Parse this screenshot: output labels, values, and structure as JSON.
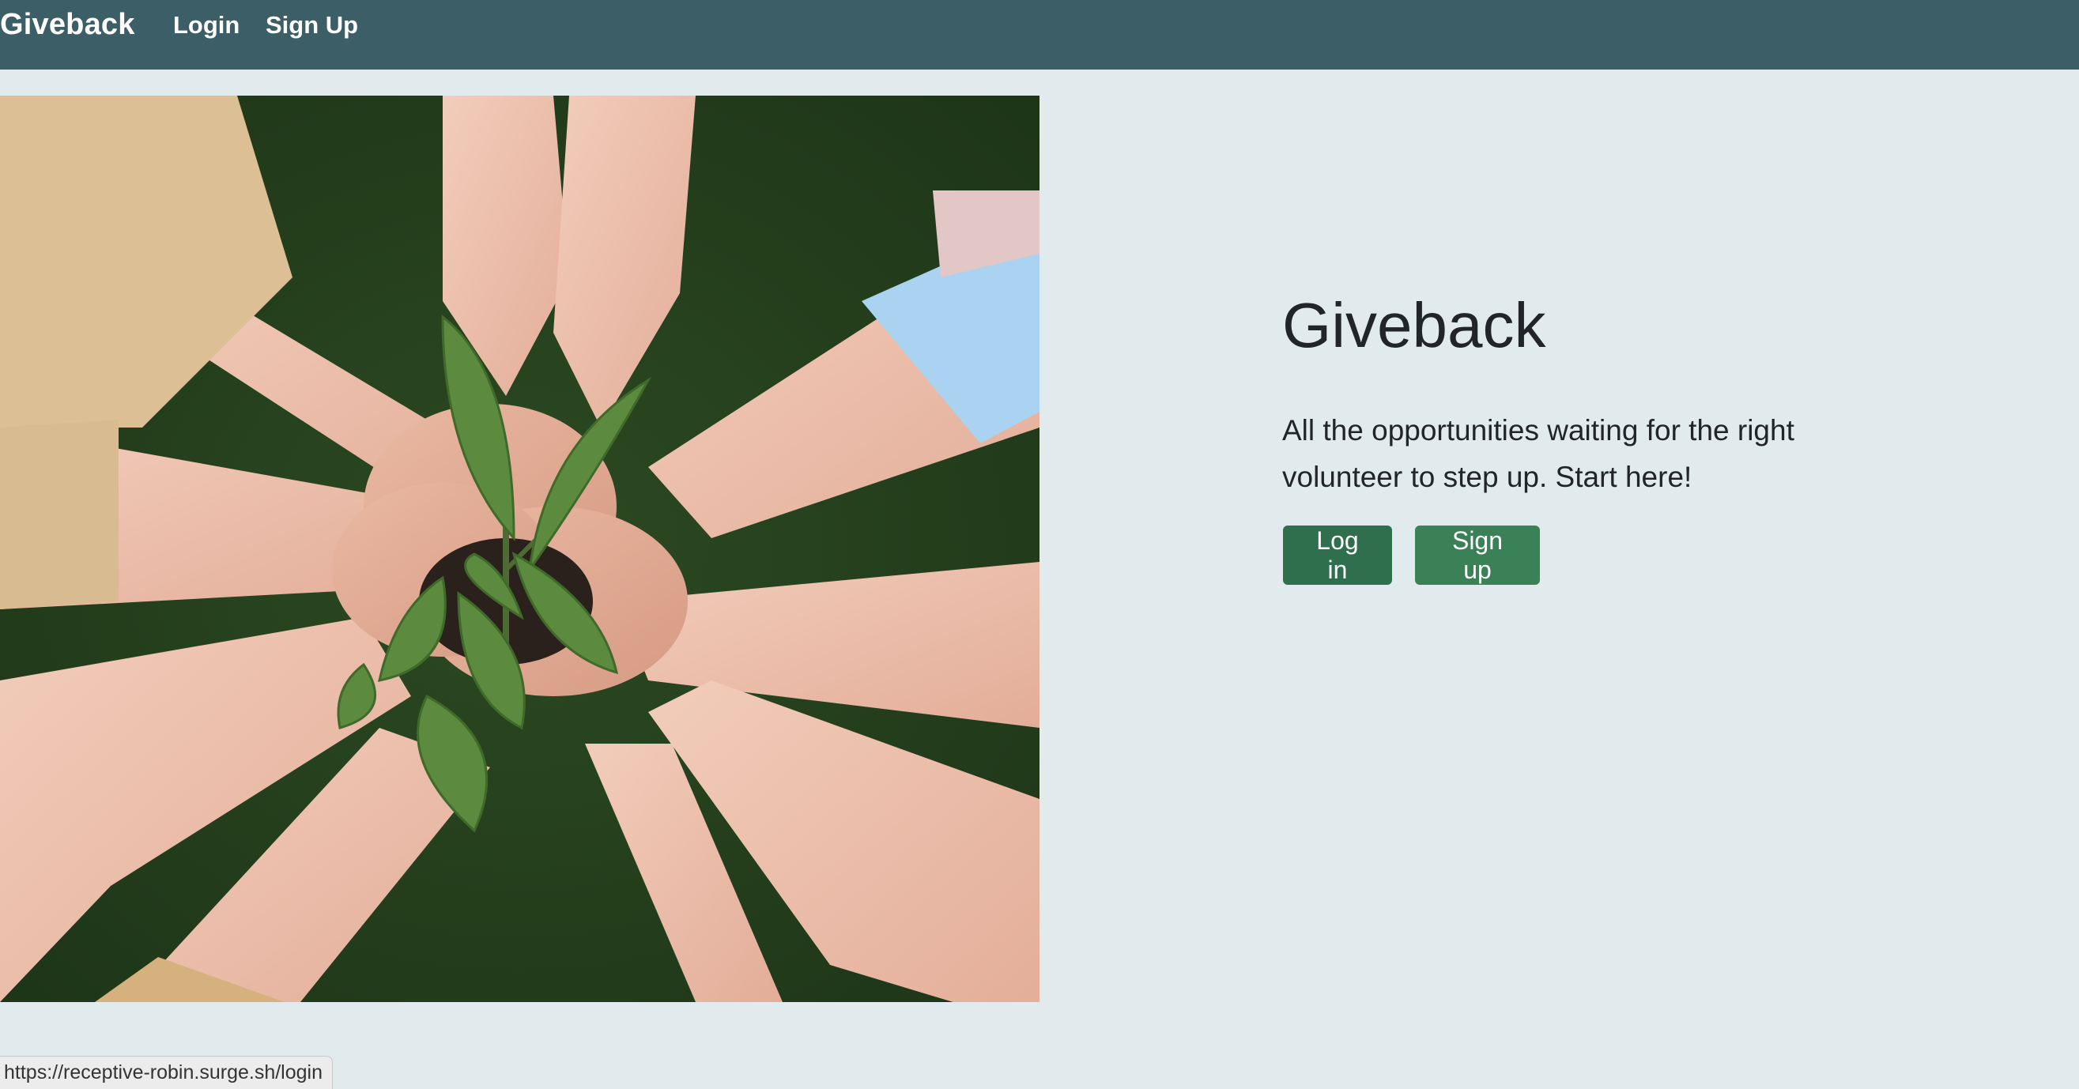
{
  "navbar": {
    "brand": "Giveback",
    "links": [
      {
        "label": "Login"
      },
      {
        "label": "Sign Up"
      }
    ],
    "background_color": "#3c5e66"
  },
  "hero": {
    "image_description_icon": "hands-holding-seedling-photo",
    "title": "Giveback",
    "lead": "All the opportunities waiting for the right volunteer to step up. Start here!",
    "buttons": {
      "login": "Log in",
      "signup": "Sign up"
    },
    "button_colors": {
      "login": "#2f6f4d",
      "signup": "#3a8158"
    }
  },
  "status_bar": {
    "url": "https://receptive-robin.surge.sh/login"
  },
  "page_background": "#e1eaec"
}
